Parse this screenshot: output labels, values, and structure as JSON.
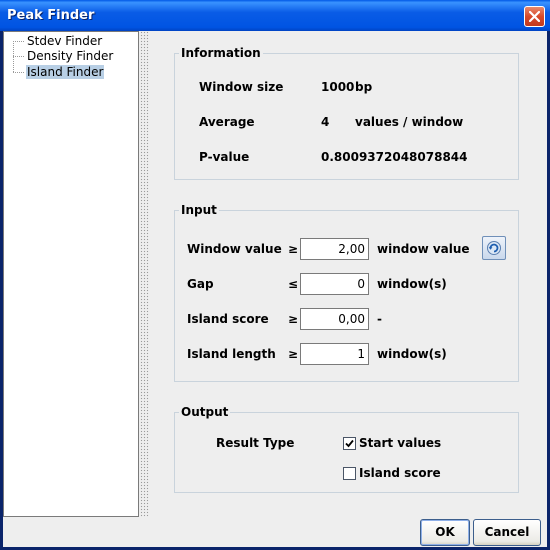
{
  "window": {
    "title": "Peak Finder"
  },
  "tree": {
    "items": [
      "Stdev Finder",
      "Density Finder",
      "Island Finder"
    ],
    "selected": "Island Finder"
  },
  "information": {
    "title": "Information",
    "window_size": {
      "label": "Window size",
      "value": "1000",
      "unit": "bp"
    },
    "average": {
      "label": "Average",
      "value": "4",
      "unit": "values / window"
    },
    "pvalue": {
      "label": "P-value",
      "value": "0.8009372048078844"
    }
  },
  "input": {
    "title": "Input",
    "rows": [
      {
        "label": "Window value",
        "op": "≥",
        "value": "2,00",
        "unit": "window value"
      },
      {
        "label": "Gap",
        "op": "≤",
        "value": "0",
        "unit": "window(s)"
      },
      {
        "label": "Island score",
        "op": "≥",
        "value": "0,00",
        "unit": "-"
      },
      {
        "label": "Island length",
        "op": "≥",
        "value": "1",
        "unit": "window(s)"
      }
    ]
  },
  "output": {
    "title": "Output",
    "result_type_label": "Result Type",
    "options": [
      {
        "label": "Start values",
        "checked": true
      },
      {
        "label": "Island score",
        "checked": false
      }
    ]
  },
  "buttons": {
    "ok": "OK",
    "cancel": "Cancel"
  },
  "icons": {
    "close": "close-icon",
    "refresh": "refresh-icon",
    "check": "checkmark-icon"
  }
}
